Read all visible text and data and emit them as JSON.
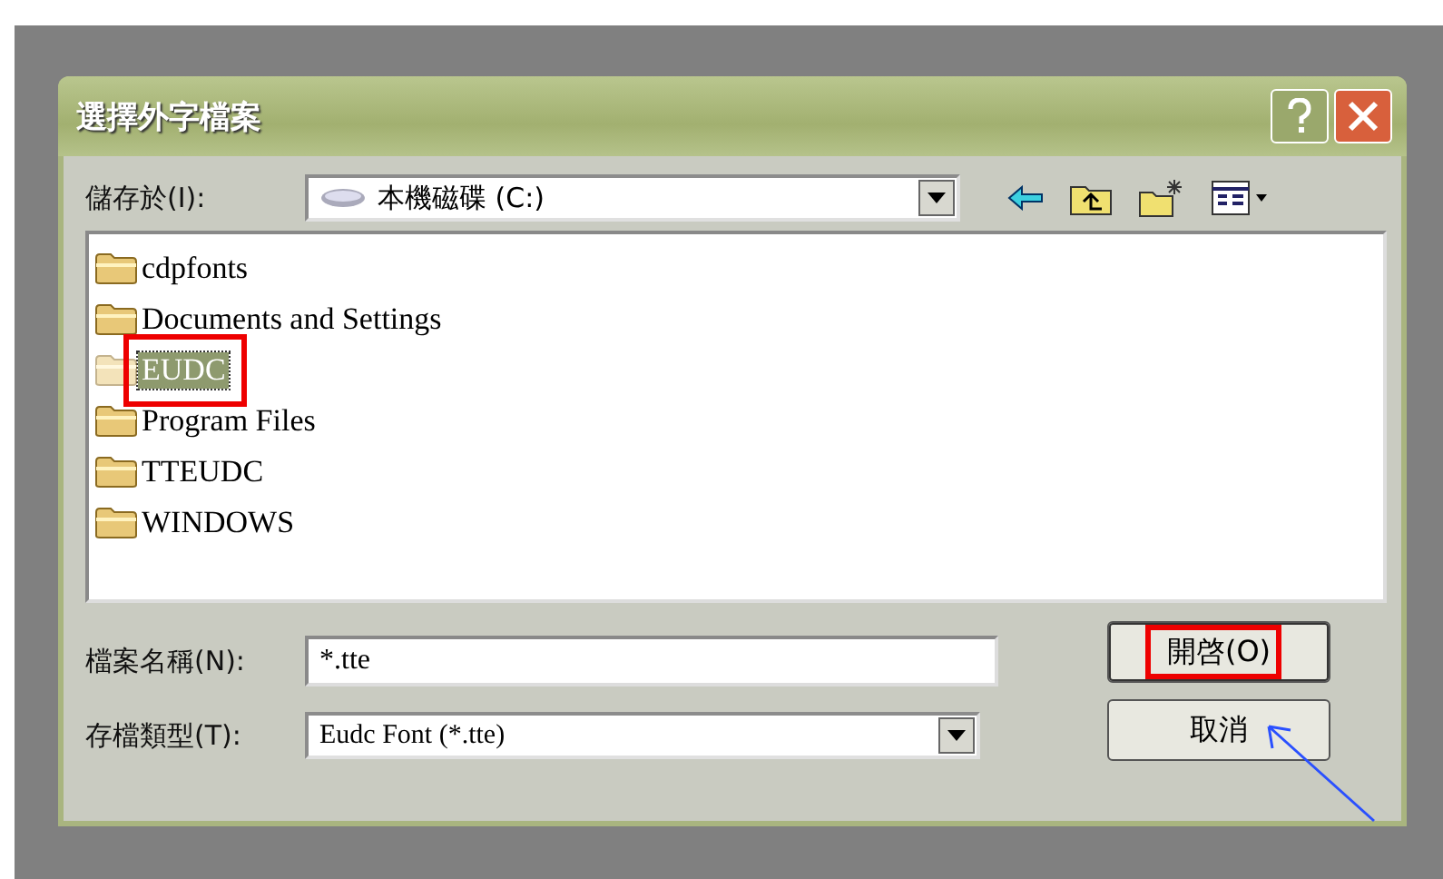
{
  "window": {
    "title": "選擇外字檔案"
  },
  "look_in": {
    "label": "儲存於(I):",
    "value": "本機磁碟 (C:)"
  },
  "files": [
    {
      "name": "cdpfonts",
      "selected": false,
      "marked": false
    },
    {
      "name": "Documents and Settings",
      "selected": false,
      "marked": false
    },
    {
      "name": "EUDC",
      "selected": true,
      "marked": true
    },
    {
      "name": "Program Files",
      "selected": false,
      "marked": false
    },
    {
      "name": "TTEUDC",
      "selected": false,
      "marked": false
    },
    {
      "name": "WINDOWS",
      "selected": false,
      "marked": false
    }
  ],
  "file_name": {
    "label": "檔案名稱(N):",
    "value": "*.tte"
  },
  "file_type": {
    "label": "存檔類型(T):",
    "value": "Eudc Font (*.tte)"
  },
  "buttons": [
    {
      "label": "開啓(O)",
      "marked": true
    },
    {
      "label": "取消",
      "marked": false
    }
  ],
  "pointer_arrow": true
}
